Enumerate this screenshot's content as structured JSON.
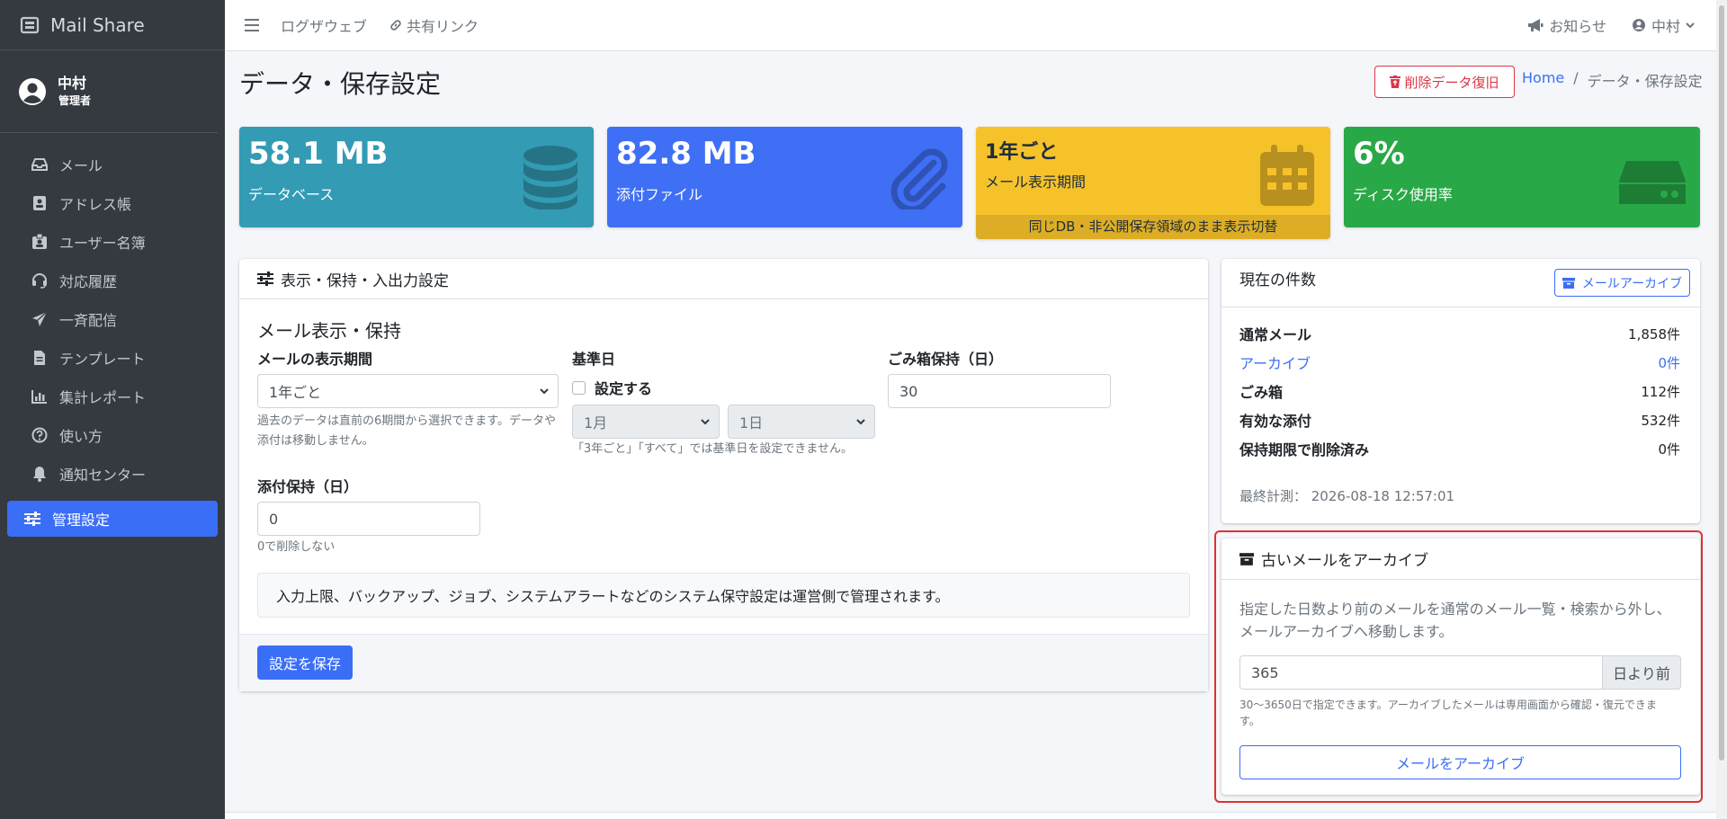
{
  "app": {
    "name": "Mail Share"
  },
  "user": {
    "name": "中村",
    "role": "管理者"
  },
  "sidebar": {
    "items": [
      {
        "label": "メール",
        "icon": "inbox-icon"
      },
      {
        "label": "アドレス帳",
        "icon": "address-book-icon"
      },
      {
        "label": "ユーザー名簿",
        "icon": "id-badge-icon"
      },
      {
        "label": "対応履歴",
        "icon": "headset-icon"
      },
      {
        "label": "一斉配信",
        "icon": "paper-plane-icon"
      },
      {
        "label": "テンプレート",
        "icon": "file-icon"
      },
      {
        "label": "集計レポート",
        "icon": "chart-bar-icon"
      },
      {
        "label": "使い方",
        "icon": "question-circle-icon"
      },
      {
        "label": "通知センター",
        "icon": "bell-icon"
      },
      {
        "label": "管理設定",
        "icon": "sliders-icon",
        "active": true
      }
    ]
  },
  "topbar": {
    "links": [
      "ログザウェブ",
      "共有リンク"
    ],
    "notice": "お知らせ",
    "user": "中村"
  },
  "header": {
    "title": "データ・保存設定",
    "restore_button": "削除データ復旧",
    "breadcrumb": {
      "home": "Home",
      "sep": "/",
      "current": "データ・保存設定"
    }
  },
  "stats": [
    {
      "value": "58.1 MB",
      "label": "データベース",
      "color": "#339bb4"
    },
    {
      "value": "82.8 MB",
      "label": "添付ファイル",
      "color": "#3f6ff5"
    },
    {
      "value": "1年ごと",
      "label": "メール表示期間",
      "footer": "同じDB・非公開保存領域のまま表示切替",
      "color": "#f6c22a"
    },
    {
      "value": "6%",
      "label": "ディスク使用率",
      "color": "#29a847"
    }
  ],
  "settings_card": {
    "header": "表示・保持・入出力設定",
    "section_title": "メール表示・保持",
    "display_period": {
      "label": "メールの表示期間",
      "value": "1年ごと",
      "help": "過去のデータは直前の6期間から選択できます。データや添付は移動しません。"
    },
    "base_date": {
      "label": "基準日",
      "checkbox_label": "設定する",
      "month": "1月",
      "day": "1日",
      "help": "「3年ごと」「すべて」では基準日を設定できません。"
    },
    "trash_keep": {
      "label": "ごみ箱保持（日）",
      "value": "30"
    },
    "attach_keep": {
      "label": "添付保持（日）",
      "value": "0",
      "help": "0で削除しない"
    },
    "notice": "入力上限、バックアップ、ジョブ、システムアラートなどのシステム保守設定は運営側で管理されます。",
    "save_button": "設定を保存"
  },
  "counts_card": {
    "header": "現在の件数",
    "archive_button": "メールアーカイブ",
    "rows": [
      {
        "label": "通常メール",
        "value": "1,858件"
      },
      {
        "label": "アーカイブ",
        "value": "0件",
        "link": true
      },
      {
        "label": "ごみ箱",
        "value": "112件"
      },
      {
        "label": "有効な添付",
        "value": "532件"
      },
      {
        "label": "保持期限で削除済み",
        "value": "0件"
      }
    ],
    "measured": "最終計測： 2026-08-18 12:57:01"
  },
  "archive_card": {
    "header": "古いメールをアーカイブ",
    "desc1": "指定した日数より前のメールを通常のメール一覧・検索から外し、",
    "desc2": "メールアーカイブへ移動します。",
    "days_value": "365",
    "days_suffix": "日より前",
    "help1": "30〜3650日で指定できます。アーカイブしたメールは専用画面から確認・復元できま",
    "help2": "す。",
    "button": "メールをアーカイブ"
  }
}
